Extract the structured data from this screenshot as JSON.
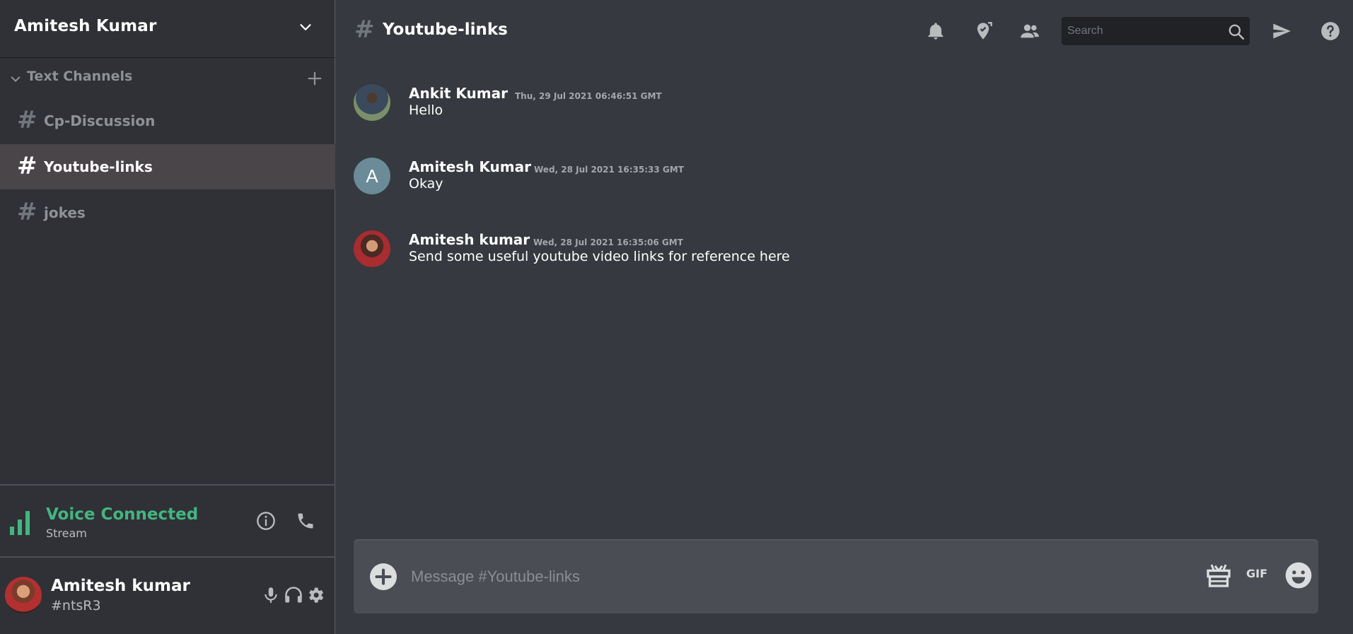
{
  "server": {
    "name": "Amitesh Kumar"
  },
  "category": {
    "label": "Text Channels"
  },
  "channels": [
    {
      "label": "Cp-Discussion",
      "hash": "#"
    },
    {
      "label": "Youtube-links",
      "hash": "#"
    },
    {
      "label": "jokes",
      "hash": "#"
    }
  ],
  "voice": {
    "title": "Voice Connected",
    "subtitle": "Stream",
    "color": "#43b581"
  },
  "user": {
    "name": "Amitesh kumar",
    "tag": "#ntsR3"
  },
  "topbar": {
    "hash": "#",
    "title": "Youtube-links",
    "search_placeholder": "Search"
  },
  "messages": [
    {
      "author": "Ankit Kumar",
      "time": "Thu, 29 Jul 2021 06:46:51 GMT",
      "text": "Hello"
    },
    {
      "author": "Amitesh Kumar",
      "time": "Wed, 28 Jul 2021 16:35:33 GMT",
      "text": "Okay",
      "avatar_letter": "A"
    },
    {
      "author": "Amitesh kumar",
      "time": "Wed, 28 Jul 2021 16:35:06 GMT",
      "text": "Send some useful youtube video links for reference here"
    }
  ],
  "composer": {
    "placeholder": "Message #Youtube-links",
    "gif_label": "GIF"
  },
  "icons": {
    "server_menu": "chevron-down-icon",
    "category_toggle": "chevron-down-icon",
    "category_add": "plus-icon",
    "voice_signal": "signal-bars-icon",
    "voice_info": "info-icon",
    "voice_disconnect": "phone-icon",
    "mic": "microphone-icon",
    "headset": "headset-icon",
    "settings": "gear-icon",
    "notifications": "bell-icon",
    "pins": "pin-icon",
    "members": "members-icon",
    "search": "search-icon",
    "inbox": "send-icon",
    "help": "help-icon",
    "attach": "plus-circle-icon",
    "gift": "gift-icon",
    "emoji": "emoji-icon"
  }
}
